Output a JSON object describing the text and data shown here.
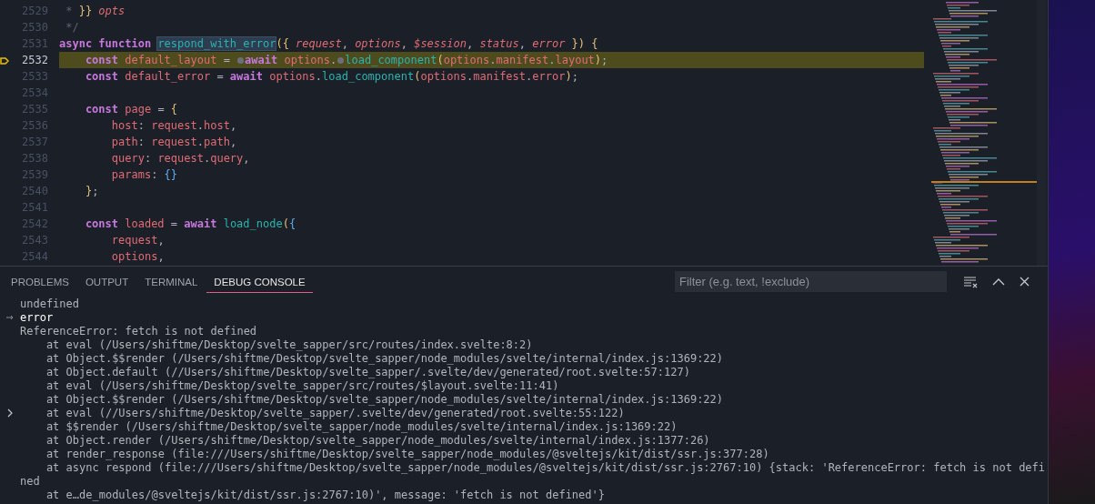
{
  "editor": {
    "lines": [
      {
        "number": "2529",
        "current": false,
        "breakpoint": false,
        "tokens": [
          {
            "kind": "comment",
            "text": " * "
          },
          {
            "kind": "brace",
            "text": "}}"
          },
          {
            "kind": "param",
            "text": " opts"
          }
        ]
      },
      {
        "number": "2530",
        "current": false,
        "breakpoint": false,
        "tokens": [
          {
            "kind": "comment",
            "text": " */"
          }
        ]
      },
      {
        "number": "2531",
        "current": false,
        "breakpoint": false,
        "tokens": [
          {
            "kind": "kw",
            "text": "async function "
          },
          {
            "kind": "fn",
            "text": "respond_with_error",
            "highlighted": true
          },
          {
            "kind": "brace",
            "text": "("
          },
          {
            "kind": "brace2",
            "text": "{"
          },
          {
            "kind": "param",
            "text": " request"
          },
          {
            "kind": "punct",
            "text": ", "
          },
          {
            "kind": "param",
            "text": "options"
          },
          {
            "kind": "punct",
            "text": ", "
          },
          {
            "kind": "param",
            "text": "$session"
          },
          {
            "kind": "punct",
            "text": ", "
          },
          {
            "kind": "param",
            "text": "status"
          },
          {
            "kind": "punct",
            "text": ", "
          },
          {
            "kind": "param",
            "text": "error "
          },
          {
            "kind": "brace2",
            "text": "}"
          },
          {
            "kind": "brace",
            "text": ") {"
          }
        ]
      },
      {
        "number": "2532",
        "current": true,
        "breakpoint": true,
        "tokens": [
          {
            "kind": "kw",
            "text": "    const "
          },
          {
            "kind": "var",
            "text": "default_layout"
          },
          {
            "kind": "punct",
            "text": " = "
          },
          {
            "kind": "bpdot"
          },
          {
            "kind": "kw",
            "text": "await "
          },
          {
            "kind": "var",
            "text": "options"
          },
          {
            "kind": "punct",
            "text": "."
          },
          {
            "kind": "bpdot"
          },
          {
            "kind": "fn",
            "text": "load_component"
          },
          {
            "kind": "brace",
            "text": "("
          },
          {
            "kind": "var",
            "text": "options"
          },
          {
            "kind": "punct",
            "text": "."
          },
          {
            "kind": "var",
            "text": "manifest"
          },
          {
            "kind": "punct",
            "text": "."
          },
          {
            "kind": "var",
            "text": "layout"
          },
          {
            "kind": "brace",
            "text": ")"
          },
          {
            "kind": "punct",
            "text": ";"
          }
        ]
      },
      {
        "number": "2533",
        "current": false,
        "breakpoint": false,
        "tokens": [
          {
            "kind": "kw",
            "text": "    const "
          },
          {
            "kind": "var",
            "text": "default_error"
          },
          {
            "kind": "punct",
            "text": " = "
          },
          {
            "kind": "kw",
            "text": "await "
          },
          {
            "kind": "var",
            "text": "options"
          },
          {
            "kind": "punct",
            "text": "."
          },
          {
            "kind": "fn",
            "text": "load_component"
          },
          {
            "kind": "brace",
            "text": "("
          },
          {
            "kind": "var",
            "text": "options"
          },
          {
            "kind": "punct",
            "text": "."
          },
          {
            "kind": "var",
            "text": "manifest"
          },
          {
            "kind": "punct",
            "text": "."
          },
          {
            "kind": "var",
            "text": "error"
          },
          {
            "kind": "brace",
            "text": ")"
          },
          {
            "kind": "punct",
            "text": ";"
          }
        ]
      },
      {
        "number": "2534",
        "current": false,
        "breakpoint": false
      },
      {
        "number": "2535",
        "current": false,
        "breakpoint": false,
        "tokens": [
          {
            "kind": "kw",
            "text": "    const "
          },
          {
            "kind": "var",
            "text": "page"
          },
          {
            "kind": "punct",
            "text": " = "
          },
          {
            "kind": "brace",
            "text": "{"
          }
        ]
      },
      {
        "number": "2536",
        "current": false,
        "breakpoint": false,
        "tokens": [
          {
            "kind": "var",
            "text": "        host"
          },
          {
            "kind": "punct",
            "text": ": "
          },
          {
            "kind": "var",
            "text": "request"
          },
          {
            "kind": "punct",
            "text": "."
          },
          {
            "kind": "var",
            "text": "host"
          },
          {
            "kind": "punct",
            "text": ","
          }
        ]
      },
      {
        "number": "2537",
        "current": false,
        "breakpoint": false,
        "tokens": [
          {
            "kind": "var",
            "text": "        path"
          },
          {
            "kind": "punct",
            "text": ": "
          },
          {
            "kind": "var",
            "text": "request"
          },
          {
            "kind": "punct",
            "text": "."
          },
          {
            "kind": "var",
            "text": "path"
          },
          {
            "kind": "punct",
            "text": ","
          }
        ]
      },
      {
        "number": "2538",
        "current": false,
        "breakpoint": false,
        "tokens": [
          {
            "kind": "var",
            "text": "        query"
          },
          {
            "kind": "punct",
            "text": ": "
          },
          {
            "kind": "var",
            "text": "request"
          },
          {
            "kind": "punct",
            "text": "."
          },
          {
            "kind": "var",
            "text": "query"
          },
          {
            "kind": "punct",
            "text": ","
          }
        ]
      },
      {
        "number": "2539",
        "current": false,
        "breakpoint": false,
        "tokens": [
          {
            "kind": "var",
            "text": "        params"
          },
          {
            "kind": "punct",
            "text": ": "
          },
          {
            "kind": "brace3",
            "text": "{}"
          }
        ]
      },
      {
        "number": "2540",
        "current": false,
        "breakpoint": false,
        "tokens": [
          {
            "kind": "brace",
            "text": "    }"
          },
          {
            "kind": "punct",
            "text": ";"
          }
        ]
      },
      {
        "number": "2541",
        "current": false,
        "breakpoint": false
      },
      {
        "number": "2542",
        "current": false,
        "breakpoint": false,
        "tokens": [
          {
            "kind": "kw",
            "text": "    const "
          },
          {
            "kind": "var",
            "text": "loaded"
          },
          {
            "kind": "punct",
            "text": " = "
          },
          {
            "kind": "kw",
            "text": "await "
          },
          {
            "kind": "fn",
            "text": "load_node"
          },
          {
            "kind": "brace",
            "text": "("
          },
          {
            "kind": "brace3",
            "text": "{"
          }
        ]
      },
      {
        "number": "2543",
        "current": false,
        "breakpoint": false,
        "tokens": [
          {
            "kind": "var",
            "text": "        request"
          },
          {
            "kind": "punct",
            "text": ","
          }
        ]
      },
      {
        "number": "2544",
        "current": false,
        "breakpoint": false,
        "tokens": [
          {
            "kind": "var",
            "text": "        options"
          },
          {
            "kind": "punct",
            "text": ","
          }
        ]
      }
    ]
  },
  "panel": {
    "tabs": [
      {
        "label": "PROBLEMS",
        "selected": false
      },
      {
        "label": "OUTPUT",
        "selected": false
      },
      {
        "label": "TERMINAL",
        "selected": false
      },
      {
        "label": "DEBUG CONSOLE",
        "selected": true
      }
    ],
    "filter": {
      "placeholder": "Filter (e.g. text, !exclude)"
    },
    "console": [
      {
        "kind": "output",
        "text": "undefined"
      },
      {
        "kind": "input",
        "text": "error"
      },
      {
        "kind": "output",
        "text": "ReferenceError: fetch is not defined"
      },
      {
        "kind": "output",
        "text": "    at eval (/Users/shiftme/Desktop/svelte_sapper/src/routes/index.svelte:8:2)"
      },
      {
        "kind": "output",
        "text": "    at Object.$$render (/Users/shiftme/Desktop/svelte_sapper/node_modules/svelte/internal/index.js:1369:22)"
      },
      {
        "kind": "output",
        "text": "    at Object.default (//Users/shiftme/Desktop/svelte_sapper/.svelte/dev/generated/root.svelte:57:127)"
      },
      {
        "kind": "output",
        "text": "    at eval (/Users/shiftme/Desktop/svelte_sapper/src/routes/$layout.svelte:11:41)"
      },
      {
        "kind": "output",
        "text": "    at Object.$$render (/Users/shiftme/Desktop/svelte_sapper/node_modules/svelte/internal/index.js:1369:22)"
      },
      {
        "kind": "expandable",
        "text": "    at eval (//Users/shiftme/Desktop/svelte_sapper/.svelte/dev/generated/root.svelte:55:122)"
      },
      {
        "kind": "output",
        "text": "    at $$render (/Users/shiftme/Desktop/svelte_sapper/node_modules/svelte/internal/index.js:1369:22)"
      },
      {
        "kind": "output",
        "text": "    at Object.render (/Users/shiftme/Desktop/svelte_sapper/node_modules/svelte/internal/index.js:1377:26)"
      },
      {
        "kind": "output",
        "text": "    at render_response (file:///Users/shiftme/Desktop/svelte_sapper/node_modules/@sveltejs/kit/dist/ssr.js:377:28)"
      },
      {
        "kind": "output",
        "text": "    at async respond (file:///Users/shiftme/Desktop/svelte_sapper/node_modules/@sveltejs/kit/dist/ssr.js:2767:10) {stack: 'ReferenceError: fetch is not defi"
      },
      {
        "kind": "output",
        "text": "ned"
      },
      {
        "kind": "output",
        "text": "    at e…de_modules/@sveltejs/kit/dist/ssr.js:2767:10)', message: 'fetch is not defined'}"
      }
    ]
  }
}
